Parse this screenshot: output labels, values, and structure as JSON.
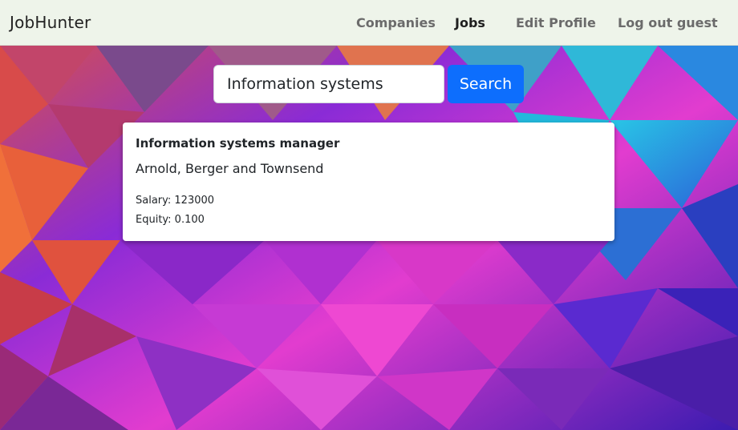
{
  "navbar": {
    "brand": "JobHunter",
    "items": [
      {
        "label": "Companies",
        "active": false
      },
      {
        "label": "Jobs",
        "active": true
      },
      {
        "label": "Edit Profile",
        "active": false
      },
      {
        "label": "Log out guest",
        "active": false
      }
    ]
  },
  "search": {
    "value": "Information systems",
    "button_label": "Search"
  },
  "results": [
    {
      "title": "Information systems manager",
      "company": "Arnold, Berger and Townsend",
      "salary": "Salary: 123000",
      "equity": "Equity: 0.100"
    }
  ],
  "colors": {
    "navbar_bg": "#eef4ea",
    "primary_button": "#0d6efd"
  }
}
